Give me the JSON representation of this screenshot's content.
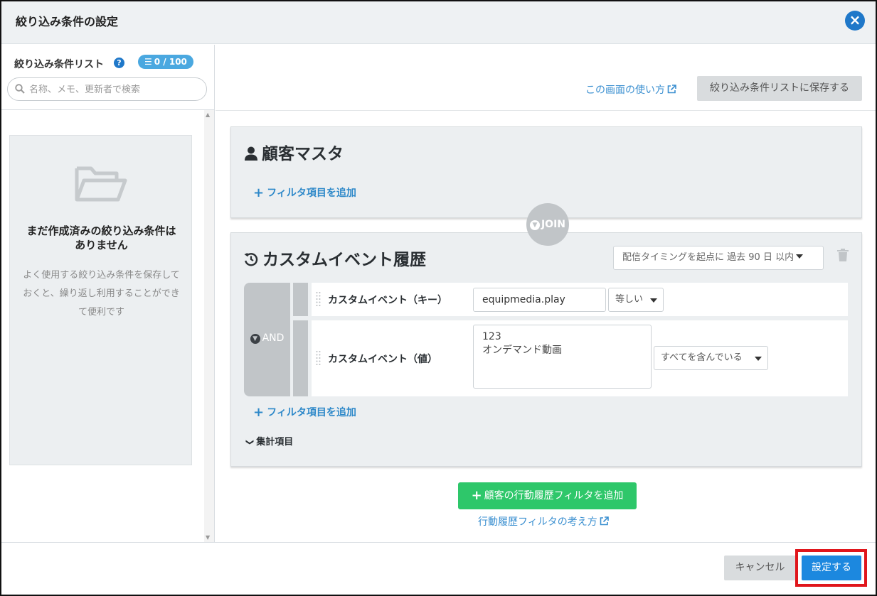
{
  "dialog": {
    "title": "絞り込み条件の設定",
    "close_icon": "×"
  },
  "sidebar": {
    "list_title": "絞り込み条件リスト",
    "help_icon": "?",
    "count_badge": "0 / 100",
    "search_placeholder": "名称、メモ、更新者で検索",
    "empty_title": "まだ作成済みの絞り込み条件はありません",
    "empty_description": "よく使用する絞り込み条件を保存しておくと、繰り返し利用することができて便利です"
  },
  "toolbar": {
    "howto_link": "この画面の使い方",
    "save_list_button": "絞り込み条件リストに保存する"
  },
  "customer_master": {
    "title": "顧客マスタ",
    "add_filter": "フィルタ項目を追加"
  },
  "join_label": "JOIN",
  "custom_event": {
    "title": "カスタムイベント履歴",
    "timing_select": "配信タイミングを起点に 過去 90 日 以内",
    "logic_label": "AND",
    "rows": [
      {
        "label": "カスタムイベント（キー）",
        "value": "equipmedia.play",
        "operator": "等しい"
      },
      {
        "label": "カスタムイベント（値）",
        "value": "123\nオンデマンド動画",
        "operator": "すべてを含んでいる"
      }
    ],
    "add_filter": "フィルタ項目を追加",
    "aggregate": "集計項目"
  },
  "add_behavior_button": "顧客の行動履歴フィルタを追加",
  "behavior_link": "行動履歴フィルタの考え方",
  "footer": {
    "cancel": "キャンセル",
    "confirm": "設定する"
  },
  "colors": {
    "accent_blue": "#1c88df",
    "add_green": "#2ec76a",
    "highlight_red": "#e0161c",
    "link_blue": "#3a8fd0"
  },
  "icons": [
    "close-icon",
    "help-icon",
    "list-icon",
    "search-icon",
    "folder-open-icon",
    "user-icon",
    "history-icon",
    "trash-icon",
    "external-link-icon",
    "grip-icon",
    "chevron-down-icon",
    "plus-icon"
  ]
}
